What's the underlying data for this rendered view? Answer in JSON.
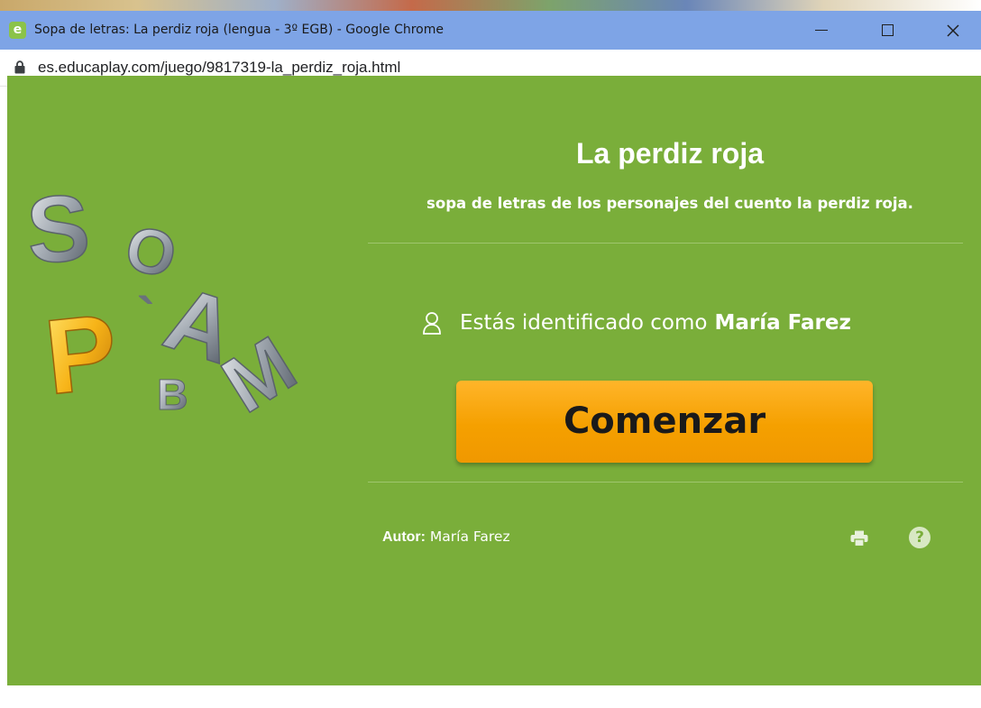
{
  "window": {
    "title": "Sopa de letras: La perdiz roja (lengua - 3º EGB) - Google Chrome",
    "app_icon_letter": "e",
    "url": "es.educaplay.com/juego/9817319-la_perdiz_roja.html"
  },
  "game": {
    "title": "La perdiz roja",
    "description": "sopa de letras de los personajes del cuento la perdiz roja.",
    "identity_text": "Estás identificado como",
    "user_name": "María Farez",
    "start_label": "Comenzar",
    "author_label": "Autor:",
    "author_name": "María Farez",
    "help_glyph": "?"
  },
  "logo": {
    "letters": [
      "S",
      "O",
      "P",
      "A",
      "M",
      "B",
      "`"
    ]
  },
  "colors": {
    "titlebar": "#7ea4e6",
    "page_background": "#7aae3a",
    "start_button": "#f5a000",
    "text": "#ffffff"
  },
  "icons": [
    "app-icon",
    "lock-icon",
    "minimize-icon",
    "maximize-icon",
    "close-icon",
    "user-icon",
    "print-icon",
    "help-icon"
  ]
}
